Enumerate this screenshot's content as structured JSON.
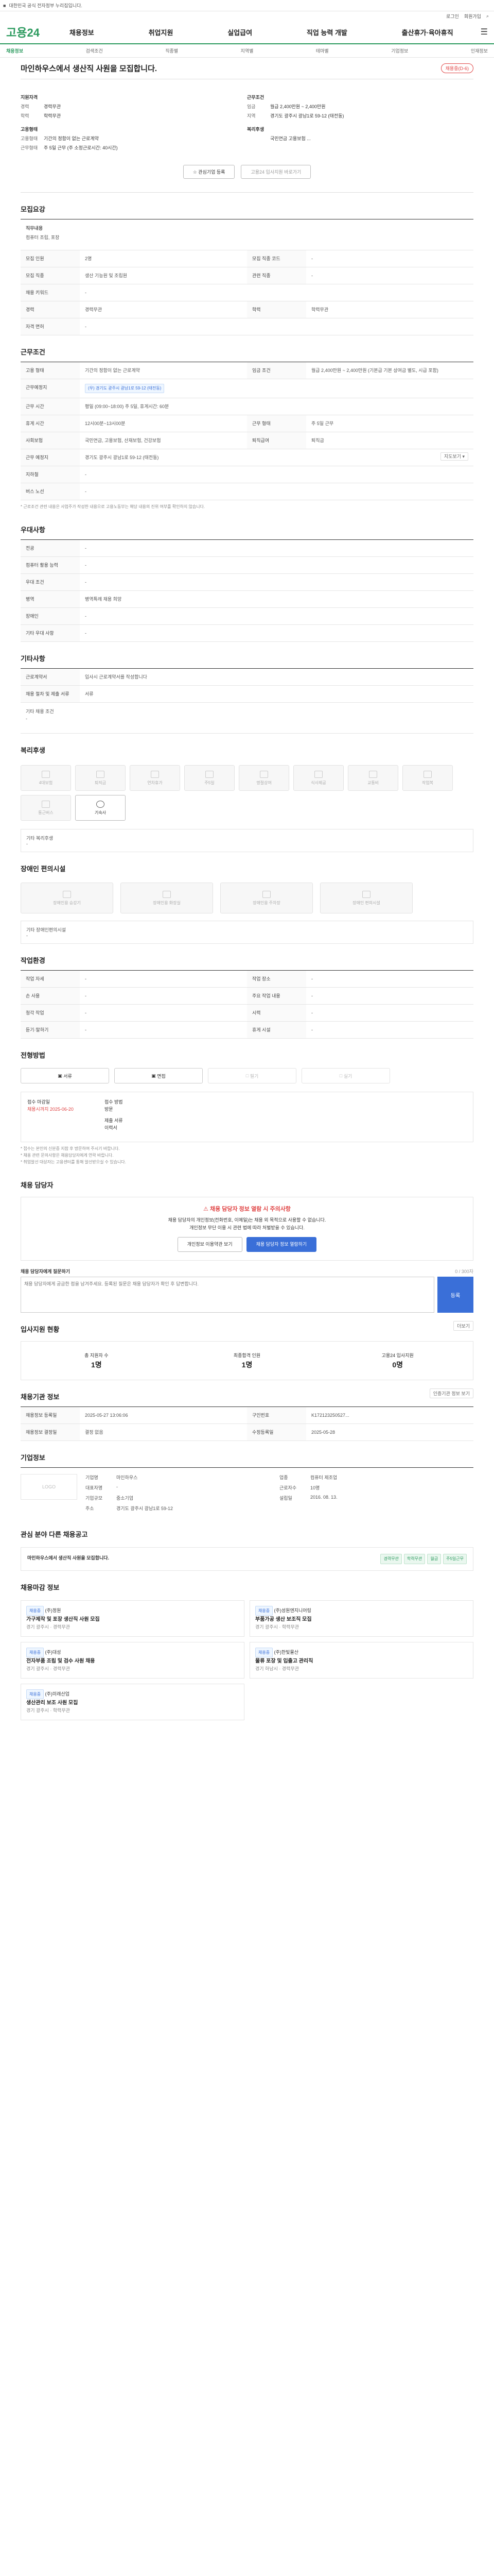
{
  "topbar": {
    "left": "고용24",
    "notice": "대한민국 공식 전자정부 누리집입니다.",
    "right": [
      "로그인",
      "회원가입"
    ]
  },
  "util": [
    "로그인",
    "회원가입",
    "검색"
  ],
  "logo": "고용24",
  "gnb": [
    "채용정보",
    "취업지원",
    "실업급여",
    "직업 능력 개발",
    "출산휴가·육아휴직",
    "기업 지원",
    "더보기"
  ],
  "sub": [
    "채용정보",
    "검색조건",
    "직종별",
    "지역별",
    "테마별",
    "기업정보",
    "인재정보"
  ],
  "title": "마인하우스에서 생산직 사원을 모집합니다.",
  "badge": "채용중(D-6)",
  "summary": {
    "left": {
      "h1": "지원자격",
      "rows": [
        [
          "경력",
          "경력무관"
        ],
        [
          "학력",
          "학력무관"
        ]
      ],
      "h2": "고용형태",
      "rows2": [
        [
          "고용형태",
          "기간의 정함이 없는 근로계약"
        ],
        [
          "근무형태",
          "주 5일 근무 (주 소정근로시간: 40시간)"
        ]
      ]
    },
    "right": {
      "h1": "근무조건",
      "rows": [
        [
          "임금",
          "월급 2,400만원 ~ 2,400만원"
        ],
        [
          "지역",
          "경기도 광주시 광남1로 59-12 (태전동)"
        ]
      ],
      "h2": "복리후생",
      "rows2": [
        [
          "",
          "국민연금 고용보험 ..."
        ]
      ]
    }
  },
  "btns": [
    "관심기업 등록",
    "고용24 입사지원 바로가기"
  ],
  "s1": {
    "title": "모집요강",
    "desc_label": "직무내용",
    "desc": "컴퓨터 조립, 포장"
  },
  "s1rows": [
    [
      "모집 인원",
      "2명",
      "모집 직종 코드",
      "-"
    ],
    [
      "모집 직종",
      "생산 기능원 및 조립원",
      "관련 직종",
      "-"
    ],
    [
      "채용 키워드",
      "-",
      "",
      ""
    ],
    [
      "경력",
      "경력무관",
      "학력",
      "학력무관"
    ],
    [
      "자격 면허",
      "-",
      "",
      ""
    ]
  ],
  "s2": {
    "title": "근무조건"
  },
  "s2rows": [
    [
      "고용 형태",
      "기간의 정함이 없는 근로계약",
      "임금 조건",
      "월급 2,400만원 ~ 2,400만원 (기본급 기본 상여금 별도, 시급 포함)"
    ],
    [
      "근무예정지",
      "(우) 경기도 광주시 광남1로 59-12 (태전동)",
      "",
      ""
    ],
    [
      "근무 시간",
      "평일 (09:00~18:00) 주 5일, 휴게시간: 60분",
      "",
      ""
    ],
    [
      "휴게 시간",
      "12시00분~13시00분",
      "근무 형태",
      "주 5일 근무"
    ],
    [
      "사회보험",
      "국민연금, 고용보험, 산재보험, 건강보험",
      "퇴직급여",
      "퇴직금"
    ],
    [
      "근무 예정지",
      "경기도 광주시 광남1로 59-12 (태전동)",
      "",
      ""
    ],
    [
      "지하철",
      "-",
      "",
      ""
    ],
    [
      "버스 노선",
      "-",
      "",
      ""
    ]
  ],
  "s2note": "* 근로조건 관련 내용은 사업주가 작성한 내용으로 고용노동부는 해당 내용의 진위 여부를 확인하지 않습니다.",
  "s3": {
    "title": "우대사항"
  },
  "s3rows": [
    [
      "전공",
      "-"
    ],
    [
      "컴퓨터 활용 능력",
      "-"
    ],
    [
      "우대 조건",
      "-"
    ],
    [
      "병역",
      "병역특례 채용 희망"
    ],
    [
      "장애인",
      "-"
    ],
    [
      "기타 우대 사항",
      "-"
    ]
  ],
  "s4": {
    "title": "기타사항"
  },
  "s4rows": [
    [
      "근로계약서",
      "입사시 근로계약서를 작성합니다"
    ],
    [
      "채용 절차 및 제출 서류",
      "서류"
    ]
  ],
  "s4etc": "기타 채용 조건",
  "s5": {
    "title": "복리후생",
    "items": [
      "4대보험",
      "퇴직금",
      "연차휴가",
      "주5일",
      "명절상여",
      "식사제공",
      "교통비",
      "작업복",
      "통근버스",
      "기숙사"
    ],
    "on_index": 9
  },
  "s5etc": "기타 복리후생",
  "s6": {
    "title": "장애인 편의시설",
    "items": [
      "장애인용 승강기",
      "장애인용 화장실",
      "장애인용 주차장",
      "장애인 편의시설"
    ]
  },
  "s6etc": "기타 장애인편의시설",
  "s7": {
    "title": "작업환경"
  },
  "s7rows": [
    [
      "작업 자세",
      "-",
      "작업 장소",
      "-"
    ],
    [
      "손 사용",
      "-",
      "주요 작업 내용",
      "-"
    ],
    [
      "청각 작업",
      "-",
      "시력",
      "-"
    ],
    [
      "듣기·말하기",
      "-",
      "휴게 시설",
      "-"
    ]
  ],
  "s8": {
    "title": "전형방법",
    "methods": [
      "서류",
      "면접",
      "필기",
      "실기"
    ],
    "active": [
      0,
      1
    ],
    "apply_label": "접수 마감일",
    "apply_val": "채용시까지 2025-06-20",
    "method_label": "접수 방법",
    "method_val": "방문",
    "docs_label": "제출 서류",
    "docs_val": "이력서",
    "notes": [
      "* 접수는 본인의 신분증 지참 후 방문하여 주시기 바랍니다.",
      "* 채용 관련 문의사항은 채용담당자에게 연락 바랍니다.",
      "* 취업알선 대상자는 고용센터를 통해 알선받으실 수 있습니다."
    ]
  },
  "s9": {
    "title": "채용 담당자",
    "warn": "채용 담당자 정보 열람 시 주의사항",
    "lines": [
      "채용 담당자의 개인정보(전화번호, 이메일)는 채용 외 목적으로 사용할 수 없습니다.",
      "개인정보 무단 이용 시 관련 법에 따라 처벌받을 수 있습니다."
    ],
    "b1": "개인정보 이용약관 보기",
    "b2": "채용 담당자 정보 열람하기"
  },
  "s9q": {
    "label": "채용 담당자에게 질문하기",
    "placeholder": "채용 담당자에게 궁금한 점을 남겨주세요. 등록된 질문은 채용 담당자가 확인 후 답변합니다.",
    "submit": "등록",
    "count": "0 / 300자"
  },
  "s10": {
    "title": "입사지원 현황",
    "more": "더보기",
    "stats": [
      [
        "총 지원자 수",
        "1명"
      ],
      [
        "최종합격 인원",
        "1명"
      ],
      [
        "고용24 입사지원",
        "0명"
      ]
    ]
  },
  "s11": {
    "title": "채용기관 정보",
    "more": "인증기관 정보 보기"
  },
  "s11rows": [
    [
      "채용정보 등록일",
      "2025-05-27 13:06:06",
      "구인번호",
      "K172123250527..."
    ],
    [
      "채용정보 결정일",
      "결정 없음",
      "수정등록일",
      "2025-05-28"
    ]
  ],
  "s12": {
    "title": "기업정보",
    "logo": "LOGO",
    "info": [
      [
        "기업명",
        "마인하우스",
        "업종",
        "컴퓨터 제조업"
      ],
      [
        "대표자명",
        "-",
        "근로자수",
        "10명"
      ],
      [
        "기업규모",
        "중소기업",
        "설립일",
        "2016. 08. 13."
      ],
      [
        "주소",
        "경기도 광주시 광남1로 59-12",
        "",
        ""
      ]
    ]
  },
  "s13": {
    "title": "관심 분야 다른 채용공고",
    "job": "마인하우스에서 생산직 사원을 모집합니다.",
    "tags": [
      "경력무관",
      "학력무관",
      "월급",
      "주5일근무"
    ]
  },
  "s14": {
    "title": "채용마감 정보",
    "items": [
      {
        "tag": "채용중",
        "co": "(주)정원",
        "title": "가구제작 및 포장 생산직 사원 모집",
        "meta": "경기 광주시 · 경력무관"
      },
      {
        "tag": "채용중",
        "co": "(주)성원엔지니어링",
        "title": "부품가공 생산 보조직 모집",
        "meta": "경기 광주시 · 학력무관"
      },
      {
        "tag": "채용중",
        "co": "(주)대성",
        "title": "전자부품 조립 및 검수 사원 채용",
        "meta": "경기 광주시 · 경력무관"
      },
      {
        "tag": "채용중",
        "co": "(주)한빛물산",
        "title": "물류 포장 및 입출고 관리직",
        "meta": "경기 하남시 · 경력무관"
      },
      {
        "tag": "채용중",
        "co": "(주)미래산업",
        "title": "생산관리 보조 사원 모집",
        "meta": "경기 광주시 · 학력무관"
      }
    ]
  }
}
